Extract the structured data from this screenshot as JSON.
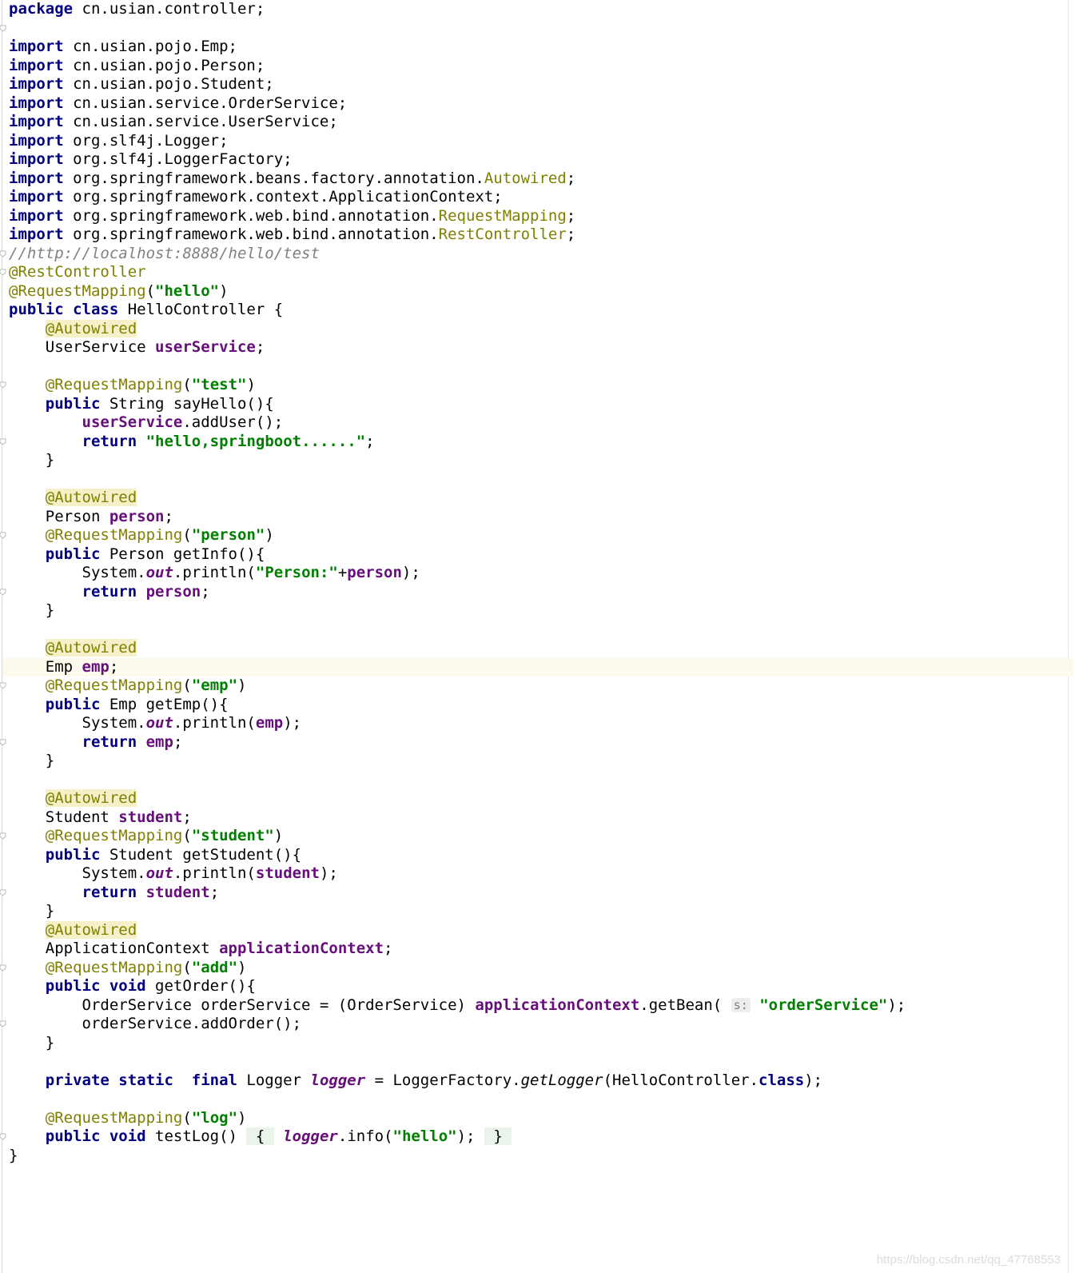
{
  "editor": {
    "language": "java",
    "colors": {
      "keyword": "#000080",
      "annotation": "#808000",
      "annotation_highlight": "#f6f0c8",
      "string": "#008000",
      "field": "#660e7a",
      "comment": "#808080",
      "current_line": "#fcfaed"
    },
    "lines": [
      {
        "tokens": [
          {
            "t": "package",
            "c": "kw"
          },
          {
            "t": " cn.usian.controller;"
          }
        ]
      },
      {
        "tokens": []
      },
      {
        "tokens": [
          {
            "t": "import",
            "c": "kw"
          },
          {
            "t": " cn.usian.pojo.Emp;"
          }
        ]
      },
      {
        "tokens": [
          {
            "t": "import",
            "c": "kw"
          },
          {
            "t": " cn.usian.pojo.Person;"
          }
        ]
      },
      {
        "tokens": [
          {
            "t": "import",
            "c": "kw"
          },
          {
            "t": " cn.usian.pojo.Student;"
          }
        ]
      },
      {
        "tokens": [
          {
            "t": "import",
            "c": "kw"
          },
          {
            "t": " cn.usian.service.OrderService;"
          }
        ]
      },
      {
        "tokens": [
          {
            "t": "import",
            "c": "kw"
          },
          {
            "t": " cn.usian.service.UserService;"
          }
        ]
      },
      {
        "tokens": [
          {
            "t": "import",
            "c": "kw"
          },
          {
            "t": " org.slf4j.Logger;"
          }
        ]
      },
      {
        "tokens": [
          {
            "t": "import",
            "c": "kw"
          },
          {
            "t": " org.slf4j.LoggerFactory;"
          }
        ]
      },
      {
        "tokens": [
          {
            "t": "import",
            "c": "kw"
          },
          {
            "t": " org.springframework.beans.factory.annotation."
          },
          {
            "t": "Autowired",
            "c": "ann"
          },
          {
            "t": ";"
          }
        ]
      },
      {
        "tokens": [
          {
            "t": "import",
            "c": "kw"
          },
          {
            "t": " org.springframework.context.ApplicationContext;"
          }
        ]
      },
      {
        "tokens": [
          {
            "t": "import",
            "c": "kw"
          },
          {
            "t": " org.springframework.web.bind.annotation."
          },
          {
            "t": "RequestMapping",
            "c": "ann"
          },
          {
            "t": ";"
          }
        ]
      },
      {
        "tokens": [
          {
            "t": "import",
            "c": "kw"
          },
          {
            "t": " org.springframework.web.bind.annotation."
          },
          {
            "t": "RestController",
            "c": "ann"
          },
          {
            "t": ";"
          }
        ]
      },
      {
        "tokens": [
          {
            "t": "//http://localhost:8888/hello/test",
            "c": "cmt"
          }
        ]
      },
      {
        "tokens": [
          {
            "t": "@RestController",
            "c": "ann"
          }
        ]
      },
      {
        "tokens": [
          {
            "t": "@RequestMapping",
            "c": "ann"
          },
          {
            "t": "("
          },
          {
            "t": "\"hello\"",
            "c": "str"
          },
          {
            "t": ")"
          }
        ]
      },
      {
        "tokens": [
          {
            "t": "public class",
            "c": "kw"
          },
          {
            "t": " HelloController {"
          }
        ]
      },
      {
        "tokens": [
          {
            "t": "    "
          },
          {
            "t": "@Autowired",
            "c": "ann-hl"
          }
        ]
      },
      {
        "tokens": [
          {
            "t": "    UserService "
          },
          {
            "t": "userService",
            "c": "fld"
          },
          {
            "t": ";"
          }
        ]
      },
      {
        "tokens": []
      },
      {
        "tokens": [
          {
            "t": "    "
          },
          {
            "t": "@RequestMapping",
            "c": "ann"
          },
          {
            "t": "("
          },
          {
            "t": "\"test\"",
            "c": "str"
          },
          {
            "t": ")"
          }
        ]
      },
      {
        "tokens": [
          {
            "t": "    "
          },
          {
            "t": "public",
            "c": "kw"
          },
          {
            "t": " String sayHello(){"
          }
        ]
      },
      {
        "tokens": [
          {
            "t": "        "
          },
          {
            "t": "userService",
            "c": "fld"
          },
          {
            "t": ".addUser();"
          }
        ]
      },
      {
        "tokens": [
          {
            "t": "        "
          },
          {
            "t": "return",
            "c": "kw"
          },
          {
            "t": " "
          },
          {
            "t": "\"hello,springboot......\"",
            "c": "str"
          },
          {
            "t": ";"
          }
        ]
      },
      {
        "tokens": [
          {
            "t": "    }"
          }
        ]
      },
      {
        "tokens": []
      },
      {
        "tokens": [
          {
            "t": "    "
          },
          {
            "t": "@Autowired",
            "c": "ann-hl"
          }
        ]
      },
      {
        "tokens": [
          {
            "t": "    Person "
          },
          {
            "t": "person",
            "c": "fld"
          },
          {
            "t": ";"
          }
        ]
      },
      {
        "tokens": [
          {
            "t": "    "
          },
          {
            "t": "@RequestMapping",
            "c": "ann"
          },
          {
            "t": "("
          },
          {
            "t": "\"person\"",
            "c": "str"
          },
          {
            "t": ")"
          }
        ]
      },
      {
        "tokens": [
          {
            "t": "    "
          },
          {
            "t": "public",
            "c": "kw"
          },
          {
            "t": " Person getInfo(){"
          }
        ]
      },
      {
        "tokens": [
          {
            "t": "        System."
          },
          {
            "t": "out",
            "c": "sfld"
          },
          {
            "t": ".println("
          },
          {
            "t": "\"Person:\"",
            "c": "str"
          },
          {
            "t": "+"
          },
          {
            "t": "person",
            "c": "fld"
          },
          {
            "t": ");"
          }
        ]
      },
      {
        "tokens": [
          {
            "t": "        "
          },
          {
            "t": "return",
            "c": "kw"
          },
          {
            "t": " "
          },
          {
            "t": "person",
            "c": "fld"
          },
          {
            "t": ";"
          }
        ]
      },
      {
        "tokens": [
          {
            "t": "    }"
          }
        ]
      },
      {
        "tokens": []
      },
      {
        "tokens": [
          {
            "t": "    "
          },
          {
            "t": "@Autowired",
            "c": "ann-hl"
          }
        ]
      },
      {
        "current": true,
        "tokens": [
          {
            "t": "    Emp "
          },
          {
            "t": "emp",
            "c": "fld"
          },
          {
            "t": ";"
          }
        ]
      },
      {
        "tokens": [
          {
            "t": "    "
          },
          {
            "t": "@RequestMapping",
            "c": "ann"
          },
          {
            "t": "("
          },
          {
            "t": "\"emp\"",
            "c": "str"
          },
          {
            "t": ")"
          }
        ]
      },
      {
        "tokens": [
          {
            "t": "    "
          },
          {
            "t": "public",
            "c": "kw"
          },
          {
            "t": " Emp getEmp(){"
          }
        ]
      },
      {
        "tokens": [
          {
            "t": "        System."
          },
          {
            "t": "out",
            "c": "sfld"
          },
          {
            "t": ".println("
          },
          {
            "t": "emp",
            "c": "fld"
          },
          {
            "t": ");"
          }
        ]
      },
      {
        "tokens": [
          {
            "t": "        "
          },
          {
            "t": "return",
            "c": "kw"
          },
          {
            "t": " "
          },
          {
            "t": "emp",
            "c": "fld"
          },
          {
            "t": ";"
          }
        ]
      },
      {
        "tokens": [
          {
            "t": "    }"
          }
        ]
      },
      {
        "tokens": []
      },
      {
        "tokens": [
          {
            "t": "    "
          },
          {
            "t": "@Autowired",
            "c": "ann-hl"
          }
        ]
      },
      {
        "tokens": [
          {
            "t": "    Student "
          },
          {
            "t": "student",
            "c": "fld"
          },
          {
            "t": ";"
          }
        ]
      },
      {
        "tokens": [
          {
            "t": "    "
          },
          {
            "t": "@RequestMapping",
            "c": "ann"
          },
          {
            "t": "("
          },
          {
            "t": "\"student\"",
            "c": "str"
          },
          {
            "t": ")"
          }
        ]
      },
      {
        "tokens": [
          {
            "t": "    "
          },
          {
            "t": "public",
            "c": "kw"
          },
          {
            "t": " Student getStudent(){"
          }
        ]
      },
      {
        "tokens": [
          {
            "t": "        System."
          },
          {
            "t": "out",
            "c": "sfld"
          },
          {
            "t": ".println("
          },
          {
            "t": "student",
            "c": "fld"
          },
          {
            "t": ");"
          }
        ]
      },
      {
        "tokens": [
          {
            "t": "        "
          },
          {
            "t": "return",
            "c": "kw"
          },
          {
            "t": " "
          },
          {
            "t": "student",
            "c": "fld"
          },
          {
            "t": ";"
          }
        ]
      },
      {
        "tokens": [
          {
            "t": "    }"
          }
        ]
      },
      {
        "tokens": [
          {
            "t": "    "
          },
          {
            "t": "@Autowired",
            "c": "ann-hl"
          }
        ]
      },
      {
        "tokens": [
          {
            "t": "    ApplicationContext "
          },
          {
            "t": "applicationContext",
            "c": "fld"
          },
          {
            "t": ";"
          }
        ]
      },
      {
        "tokens": [
          {
            "t": "    "
          },
          {
            "t": "@RequestMapping",
            "c": "ann"
          },
          {
            "t": "("
          },
          {
            "t": "\"add\"",
            "c": "str"
          },
          {
            "t": ")"
          }
        ]
      },
      {
        "tokens": [
          {
            "t": "    "
          },
          {
            "t": "public void",
            "c": "kw"
          },
          {
            "t": " getOrder(){"
          }
        ]
      },
      {
        "tokens": [
          {
            "t": "        OrderService orderService = (OrderService) "
          },
          {
            "t": "applicationContext",
            "c": "fld"
          },
          {
            "t": ".getBean( "
          },
          {
            "t": "s:",
            "c": "hint"
          },
          {
            "t": " "
          },
          {
            "t": "\"orderService\"",
            "c": "str"
          },
          {
            "t": ");"
          }
        ]
      },
      {
        "tokens": [
          {
            "t": "        orderService.addOrder();"
          }
        ]
      },
      {
        "tokens": [
          {
            "t": "    }"
          }
        ]
      },
      {
        "tokens": []
      },
      {
        "tokens": [
          {
            "t": "    "
          },
          {
            "t": "private static  final",
            "c": "kw"
          },
          {
            "t": " Logger "
          },
          {
            "t": "logger",
            "c": "sfld"
          },
          {
            "t": " = LoggerFactory."
          },
          {
            "t": "getLogger",
            "c": "smeth"
          },
          {
            "t": "(HelloController."
          },
          {
            "t": "class",
            "c": "kw"
          },
          {
            "t": ");"
          }
        ]
      },
      {
        "tokens": []
      },
      {
        "tokens": [
          {
            "t": "    "
          },
          {
            "t": "@RequestMapping",
            "c": "ann"
          },
          {
            "t": "("
          },
          {
            "t": "\"log\"",
            "c": "str"
          },
          {
            "t": ")"
          }
        ]
      },
      {
        "tokens": [
          {
            "t": "    "
          },
          {
            "t": "public void",
            "c": "kw"
          },
          {
            "t": " testLog() "
          },
          {
            "t": " { ",
            "c": "brace-hl"
          },
          {
            "t": " "
          },
          {
            "t": "logger",
            "c": "sfld"
          },
          {
            "t": ".info("
          },
          {
            "t": "\"hello\"",
            "c": "str"
          },
          {
            "t": "); "
          },
          {
            "t": " } ",
            "c": "brace-hl"
          }
        ]
      },
      {
        "tokens": [
          {
            "t": "}"
          }
        ]
      }
    ]
  },
  "watermark": "https://blog.csdn.net/qq_47768553",
  "fold_marker_lines": [
    2,
    14,
    15,
    21,
    24,
    29,
    32,
    37,
    40,
    45,
    48,
    52,
    55,
    61
  ]
}
